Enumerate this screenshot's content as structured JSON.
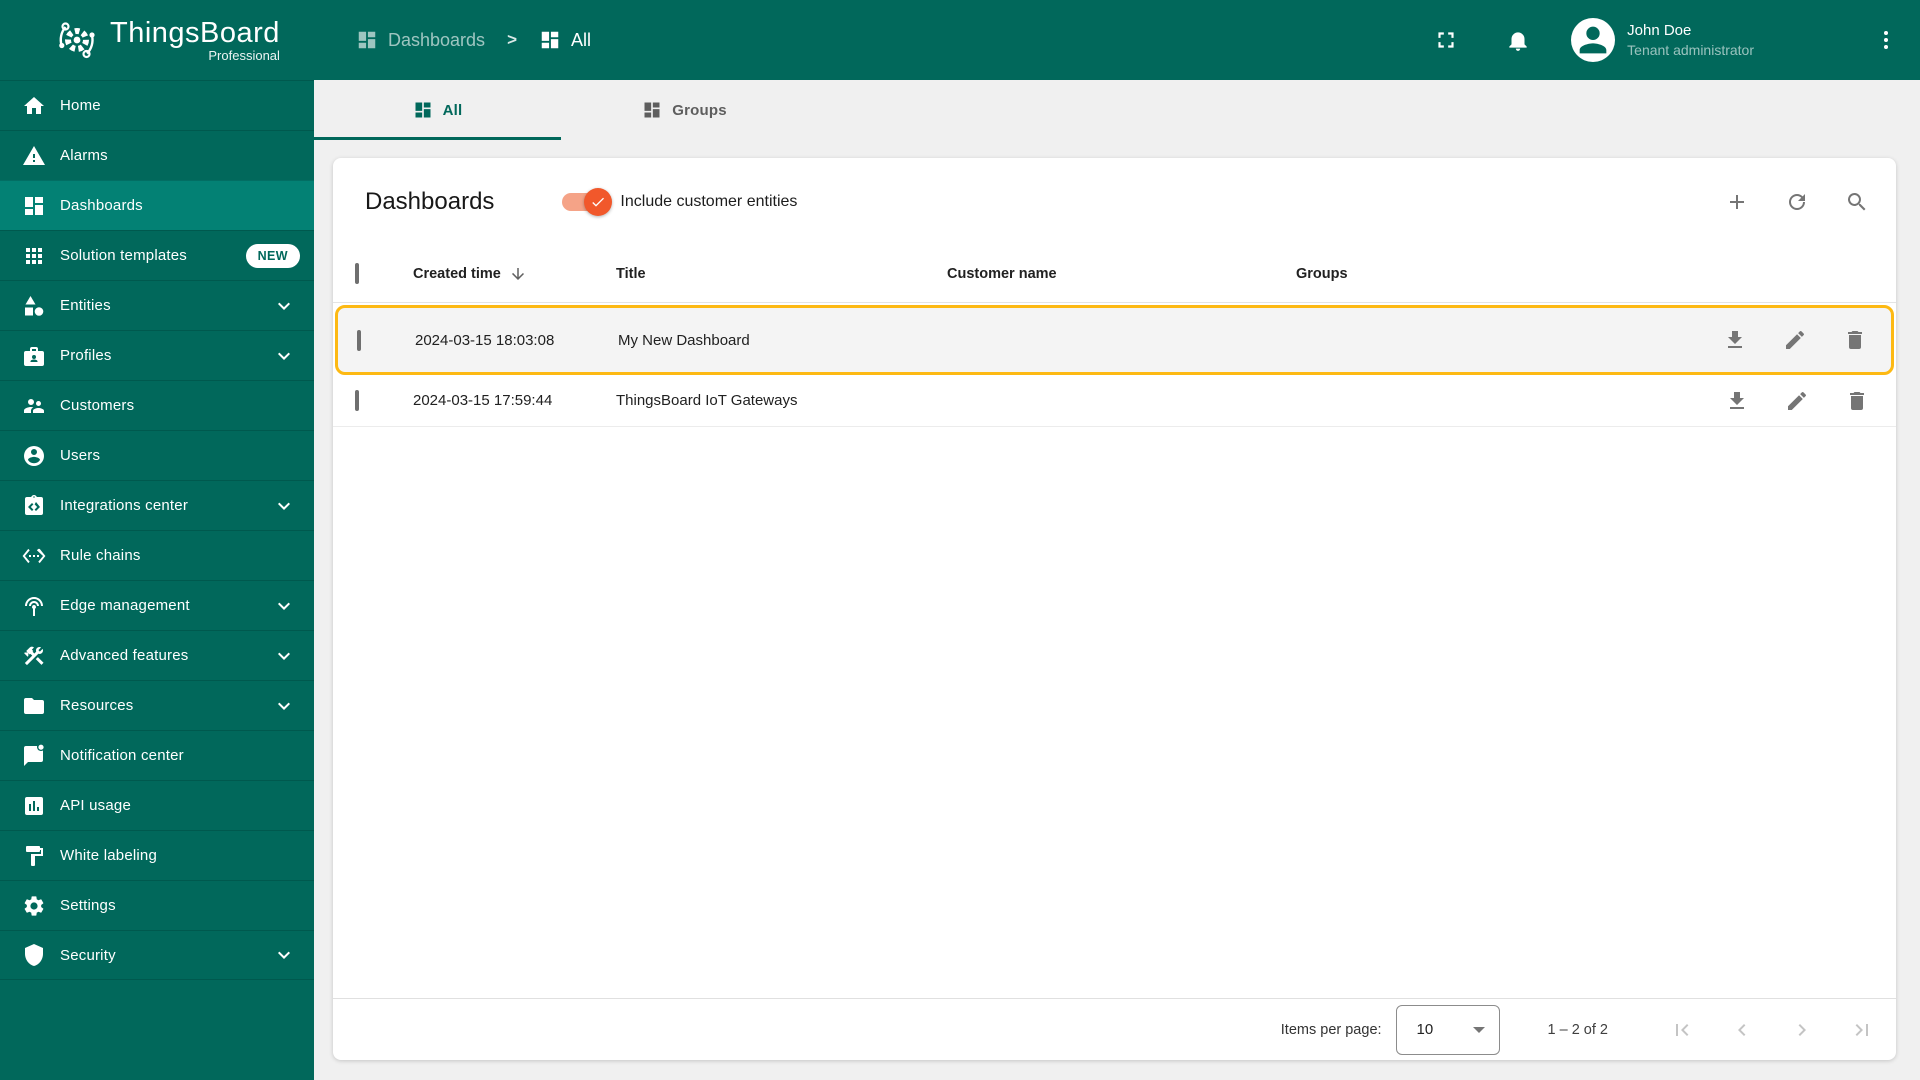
{
  "brand": {
    "title": "ThingsBoard",
    "subtitle": "Professional"
  },
  "topbar": {
    "breadcrumb": {
      "root": "Dashboards",
      "separator": ">",
      "current": "All"
    },
    "user": {
      "name": "John Doe",
      "role": "Tenant administrator"
    }
  },
  "tabs": {
    "all": "All",
    "groups": "Groups"
  },
  "sidebar": {
    "items": [
      {
        "label": "Home"
      },
      {
        "label": "Alarms"
      },
      {
        "label": "Dashboards"
      },
      {
        "label": "Solution templates",
        "badge": "NEW"
      },
      {
        "label": "Entities"
      },
      {
        "label": "Profiles"
      },
      {
        "label": "Customers"
      },
      {
        "label": "Users"
      },
      {
        "label": "Integrations center"
      },
      {
        "label": "Rule chains"
      },
      {
        "label": "Edge management"
      },
      {
        "label": "Advanced features"
      },
      {
        "label": "Resources"
      },
      {
        "label": "Notification center"
      },
      {
        "label": "API usage"
      },
      {
        "label": "White labeling"
      },
      {
        "label": "Settings"
      },
      {
        "label": "Security"
      }
    ]
  },
  "page": {
    "title": "Dashboards",
    "toggle_label": "Include customer entities",
    "toggle_on": true
  },
  "table": {
    "headers": {
      "created": "Created time",
      "title": "Title",
      "customer": "Customer name",
      "groups": "Groups"
    },
    "rows": [
      {
        "created": "2024-03-15 18:03:08",
        "title": "My New Dashboard",
        "customer": "",
        "groups": ""
      },
      {
        "created": "2024-03-15 17:59:44",
        "title": "ThingsBoard IoT Gateways",
        "customer": "",
        "groups": ""
      }
    ]
  },
  "paginator": {
    "items_per_page_label": "Items per page:",
    "page_size": "10",
    "range": "1 – 2 of 2"
  },
  "colors": {
    "primary_teal": "#01685B",
    "sidebar_active": "#038174",
    "accent_orange": "#F1582B",
    "toggle_track": "#F5A387",
    "highlight_border": "#FDB913",
    "icon_gray": "#757575",
    "content_bg": "#f0f0f0"
  }
}
